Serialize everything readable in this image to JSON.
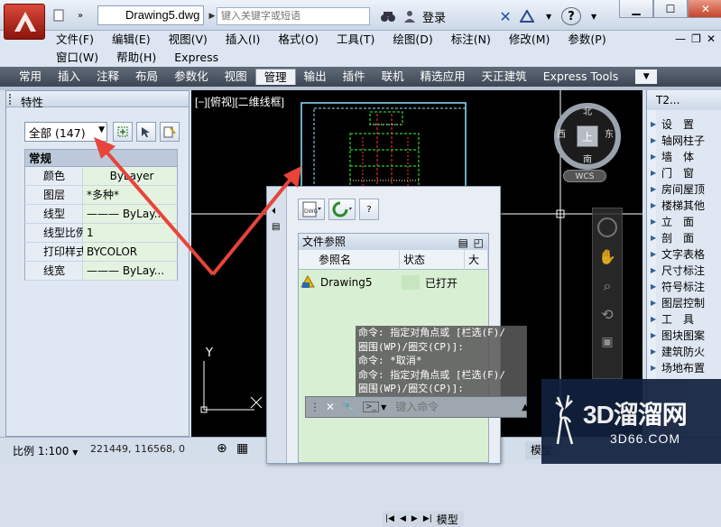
{
  "title_bar": {
    "document": "Drawing5.dwg",
    "search_placeholder": "键入关键字或短语",
    "login": "登录",
    "help_label": "?"
  },
  "menu": {
    "row1": [
      "文件(F)",
      "编辑(E)",
      "视图(V)",
      "插入(I)",
      "格式(O)",
      "工具(T)",
      "绘图(D)",
      "标注(N)",
      "修改(M)",
      "参数(P)"
    ],
    "row2": [
      "窗口(W)",
      "帮助(H)",
      "Express"
    ]
  },
  "ribbon_tabs": [
    "常用",
    "插入",
    "注释",
    "布局",
    "参数化",
    "视图",
    "管理",
    "输出",
    "插件",
    "联机",
    "精选应用",
    "天正建筑",
    "Express Tools"
  ],
  "ribbon_active": "管理",
  "properties": {
    "title": "特性",
    "selection": "全部 (147)",
    "category": "常规",
    "rows": [
      {
        "name": "颜色",
        "value": "ByLayer"
      },
      {
        "name": "图层",
        "value": "*多种*"
      },
      {
        "name": "线型",
        "value": "——— ByLay..."
      },
      {
        "name": "线型比例",
        "value": "1"
      },
      {
        "name": "打印样式",
        "value": "BYCOLOR"
      },
      {
        "name": "线宽",
        "value": "——— ByLay..."
      }
    ]
  },
  "viewport": {
    "label": "[−][俯视][二维线框]",
    "cube_top": "上",
    "north": "北",
    "south": "南",
    "east": "东",
    "west": "西",
    "wcs": "WCS",
    "axis_y": "Y"
  },
  "xref": {
    "panel_title": "文件参照",
    "col_name": "参照名",
    "col_status": "状态",
    "col_size": "大小",
    "row_name": "Drawing5",
    "row_status": "已打开"
  },
  "command": {
    "history": [
      "命令: 指定对角点或 [栏选(F)/",
      "圈围(WP)/圈交(CP)]:",
      "命令: *取消*",
      "命令: 指定对角点或 [栏选(F)/",
      "圈围(WP)/圈交(CP)]:"
    ],
    "placeholder": "键入命令"
  },
  "tool_palette": {
    "title": "T2...",
    "items": [
      "设　置",
      "轴网柱子",
      "墙　体",
      "门　窗",
      "房间屋顶",
      "楼梯其他",
      "立　面",
      "剖　面",
      "文字表格",
      "尺寸标注",
      "符号标注",
      "图层控制",
      "工　具",
      "图块图案",
      "建筑防火",
      "场地布置"
    ]
  },
  "status_bar": {
    "scale": "比例 1:100",
    "coords": "221449, 116568, 0",
    "model_tab": "模型",
    "layout_tab": "模型"
  },
  "watermark": {
    "text": "3D溜溜网",
    "sub": "3D66.COM"
  },
  "colors": {
    "arrow": "#e8443a",
    "drawing_bg": "#000000"
  }
}
